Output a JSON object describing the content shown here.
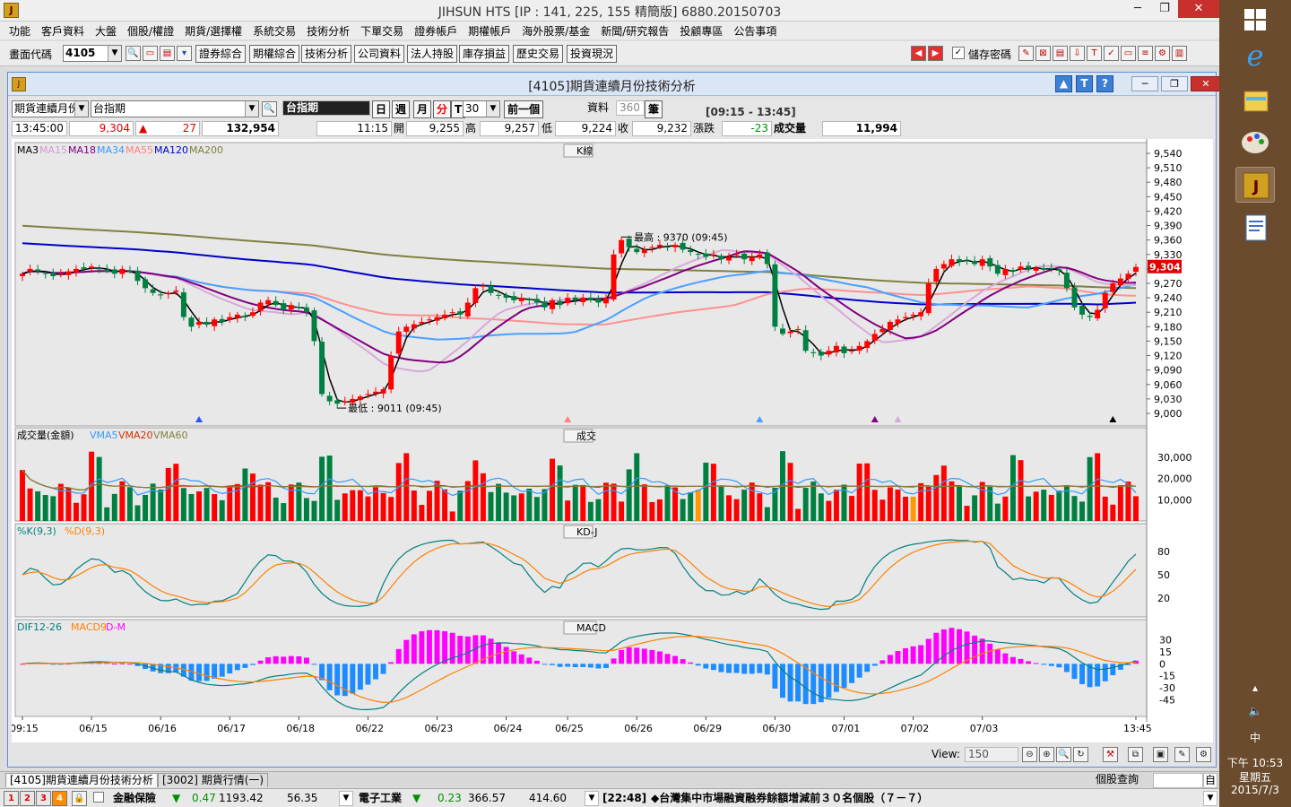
{
  "window": {
    "title": "JIHSUN HTS      [IP : 141, 225, 155 精簡版] 6880.20150703",
    "minimize": "─",
    "restore": "❐",
    "close": "✕"
  },
  "menu": [
    "功能",
    "客戶資料",
    "大盤",
    "個股/權證",
    "期貨/選擇權",
    "系統交易",
    "技術分析",
    "下單交易",
    "證券帳戶",
    "期權帳戶",
    "海外股票/基金",
    "新聞/研究報告",
    "投顧專區",
    "公告事項"
  ],
  "toolbar": {
    "code_label": "畫面代碼",
    "code_value": "4105",
    "buttons": [
      "證券綜合",
      "期權綜合",
      "技術分析",
      "公司資料",
      "法人持股",
      "庫存損益",
      "歷史交易",
      "投資現況"
    ],
    "save_pwd_label": "儲存密碼",
    "save_pwd_checked": true
  },
  "child": {
    "title": "[4105]期貨連續月份技術分析",
    "combo_product": "期貨連續月份",
    "combo_symbol": "台指期",
    "symbol_name": "台指期",
    "period_buttons": [
      "日",
      "週",
      "月",
      "分",
      "T"
    ],
    "interval": "30",
    "prev_btn": "前一個",
    "data_label": "資料",
    "data_count": "360",
    "bi_label": "筆",
    "session": "[09:15 - 13:45]",
    "time": "13:45:00",
    "price": "9,304",
    "change_arrow": "▲",
    "change": "27",
    "volume_total": "132,954",
    "bar_time": "11:15",
    "open_label": "開",
    "open": "9,255",
    "high_label": "高",
    "high": "9,257",
    "low_label": "低",
    "low": "9,224",
    "close_label": "收",
    "close": "9,232",
    "chg_label": "漲跌",
    "chg": "-23",
    "vol_label": "成交量",
    "vol": "11,994"
  },
  "panels": {
    "k": {
      "title": "K線",
      "legend": [
        {
          "t": "MA3",
          "c": "#000000"
        },
        {
          "t": "MA15",
          "c": "#d29ad2"
        },
        {
          "t": "MA18",
          "c": "#800080"
        },
        {
          "t": "MA34",
          "c": "#3399ff"
        },
        {
          "t": "MA55",
          "c": "#ff8080"
        },
        {
          "t": "MA120",
          "c": "#0000cc"
        },
        {
          "t": "MA200",
          "c": "#808040"
        }
      ],
      "yticks": [
        "9,540",
        "9,510",
        "9,480",
        "9,450",
        "9,420",
        "9,390",
        "9,360",
        "9,330",
        "9,300",
        "9,270",
        "9,240",
        "9,210",
        "9,180",
        "9,150",
        "9,120",
        "9,090",
        "9,060",
        "9,030",
        "9,000"
      ],
      "last_price_tag": "9,304",
      "high_note": "最高 : 9370 (09:45)",
      "low_note": "最低 : 9011 (09:45)"
    },
    "vol": {
      "title": "成交",
      "legend": [
        {
          "t": "成交量(金額)",
          "c": "#000000"
        },
        {
          "t": "VMA5",
          "c": "#3399ff"
        },
        {
          "t": "VMA20",
          "c": "#cc3300"
        },
        {
          "t": "VMA60",
          "c": "#808040"
        }
      ],
      "yticks": [
        "30,000",
        "20,000",
        "10,000"
      ]
    },
    "kd": {
      "title": "KD-J",
      "legend": [
        {
          "t": "%K(9,3)",
          "c": "#008080"
        },
        {
          "t": "%D(9,3)",
          "c": "#ff8000"
        }
      ],
      "yticks": [
        "80",
        "50",
        "20"
      ]
    },
    "macd": {
      "title": "MACD",
      "legend": [
        {
          "t": "DIF12-26",
          "c": "#008080"
        },
        {
          "t": "MACD9",
          "c": "#ff8000"
        },
        {
          "t": "D-M",
          "c": "#ff00ff"
        }
      ],
      "yticks": [
        "30",
        "15",
        "0",
        "-15",
        "-30",
        "-45"
      ]
    }
  },
  "xaxis": [
    "09:15",
    "06/15",
    "06/16",
    "06/17",
    "06/18",
    "06/22",
    "06/23",
    "06/24",
    "06/25",
    "06/26",
    "06/29",
    "06/30",
    "07/01",
    "07/02",
    "07/03",
    "13:45"
  ],
  "view": {
    "label": "View:",
    "value": "150"
  },
  "tabs": [
    "[4105]期貨連續月份技術分析",
    "[3002] 期貨行情(一)"
  ],
  "query_label": "個股查詢",
  "ticker": {
    "num_buttons": [
      "1",
      "2",
      "3",
      "4"
    ],
    "item1_name": "金融保險",
    "item1_arrow": "▼",
    "item1_chg": "0.47",
    "item1_val": "1193.42",
    "item1_vol": "56.35",
    "item2_name": "電子工業",
    "item2_arrow": "▼",
    "item2_chg": "0.23",
    "item2_val": "366.57",
    "item2_vol": "414.60",
    "news_time": "[22:48]",
    "news_text": "◆台灣集中市場融資融券餘額增減前３０名個股（７－７）"
  },
  "taskbar": {
    "time": "下午 10:53",
    "weekday": "星期五",
    "date": "2015/7/3",
    "ime": "中"
  },
  "chart_data": {
    "type": "candlestick",
    "interval_minutes": 30,
    "ylim": [
      9000,
      9540
    ],
    "closes": [
      9290,
      9300,
      9295,
      9290,
      9285,
      9290,
      9295,
      9300,
      9300,
      9305,
      9300,
      9295,
      9290,
      9300,
      9295,
      9275,
      9260,
      9250,
      9245,
      9250,
      9255,
      9200,
      9180,
      9190,
      9185,
      9195,
      9190,
      9200,
      9205,
      9200,
      9210,
      9230,
      9235,
      9225,
      9215,
      9225,
      9220,
      9210,
      9150,
      9040,
      9025,
      9020,
      9025,
      9030,
      9035,
      9040,
      9045,
      9050,
      9120,
      9170,
      9180,
      9185,
      9190,
      9195,
      9200,
      9205,
      9210,
      9205,
      9230,
      9260,
      9265,
      9250,
      9245,
      9240,
      9235,
      9240,
      9235,
      9230,
      9220,
      9235,
      9225,
      9240,
      9235,
      9240,
      9235,
      9230,
      9240,
      9330,
      9360,
      9345,
      9335,
      9340,
      9345,
      9350,
      9345,
      9350,
      9340,
      9335,
      9330,
      9325,
      9330,
      9320,
      9325,
      9330,
      9320,
      9325,
      9330,
      9310,
      9180,
      9165,
      9170,
      9175,
      9130,
      9125,
      9120,
      9130,
      9140,
      9125,
      9130,
      9140,
      9150,
      9165,
      9175,
      9190,
      9195,
      9200,
      9205,
      9210,
      9270,
      9300,
      9310,
      9320,
      9315,
      9318,
      9310,
      9320,
      9305,
      9290,
      9300,
      9295,
      9305,
      9300,
      9302,
      9298,
      9300,
      9296,
      9260,
      9220,
      9205,
      9200,
      9215,
      9250,
      9270,
      9280,
      9290,
      9304
    ]
  }
}
